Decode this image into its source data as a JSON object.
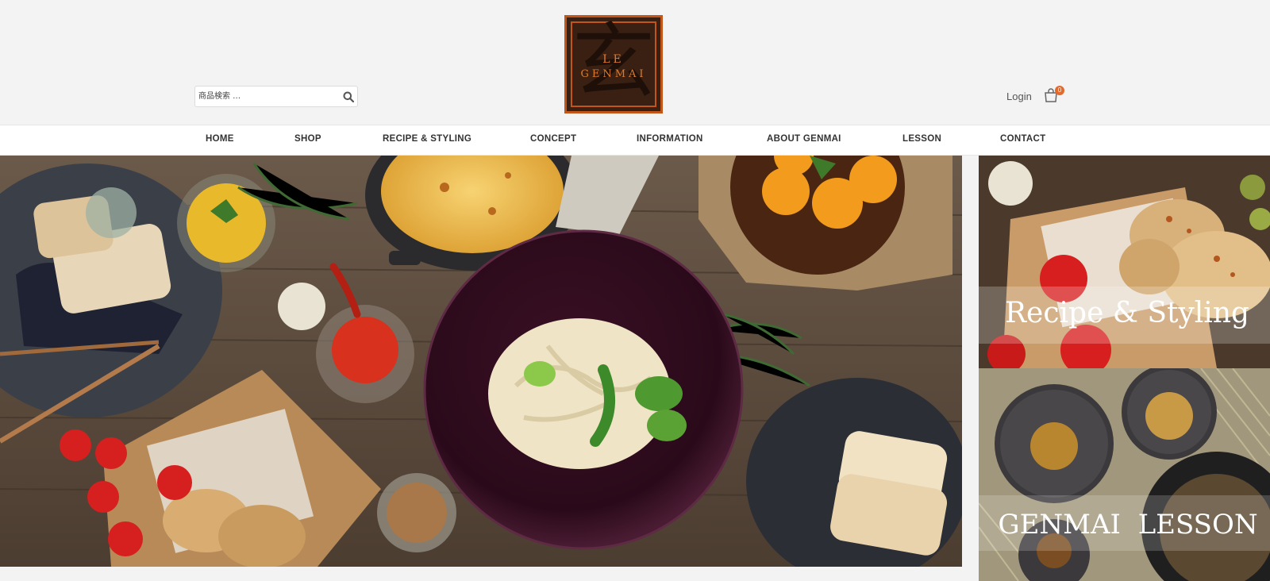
{
  "logo": {
    "line1": "Le",
    "line2": "Genmai",
    "kanji": "玄"
  },
  "search": {
    "placeholder": "商品検索 …"
  },
  "header": {
    "login_label": "Login",
    "cart_count": "0"
  },
  "nav": {
    "items": [
      {
        "label": "HOME"
      },
      {
        "label": "SHOP"
      },
      {
        "label": "RECIPE & STYLING"
      },
      {
        "label": "CONCEPT"
      },
      {
        "label": "INFORMATION"
      },
      {
        "label": "ABOUT GENMAI"
      },
      {
        "label": "LESSON"
      },
      {
        "label": "CONTACT"
      }
    ]
  },
  "banners": {
    "recipe": "Recipe & Styling",
    "lesson": "GENMAI  LESSON"
  },
  "colors": {
    "accent": "#e26a2c",
    "logo_bg": "#3a2012",
    "logo_border": "#c2561a"
  }
}
